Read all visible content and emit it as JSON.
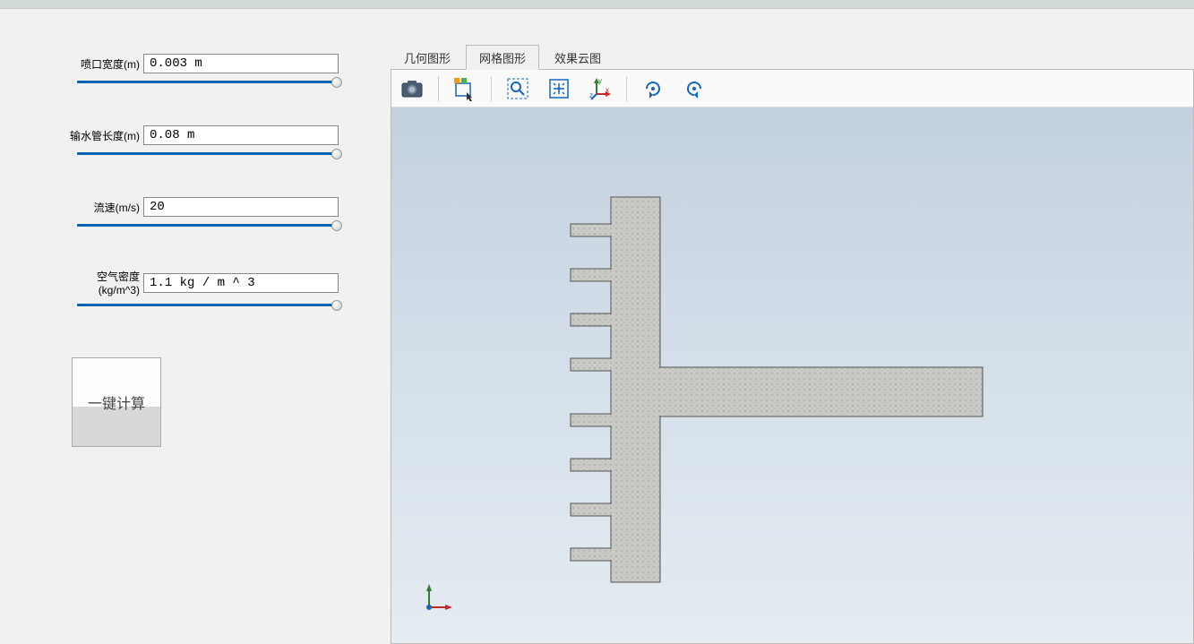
{
  "params": {
    "nozzle_width": {
      "label": "喷口宽度(m)",
      "value": "0.003 m"
    },
    "pipe_length": {
      "label": "输水管长度(m)",
      "value": "0.08 m"
    },
    "flow_speed": {
      "label": "流速(m/s)",
      "value": "20"
    },
    "air_density": {
      "label": "空气密度(kg/m^3)",
      "value": "1.1 kg / m ^ 3"
    }
  },
  "calc_button": "一键计算",
  "tabs": {
    "geometry": "几何图形",
    "mesh": "网格图形",
    "result": "效果云图"
  },
  "axis": {
    "x": "x",
    "y": "y",
    "z": "z"
  }
}
